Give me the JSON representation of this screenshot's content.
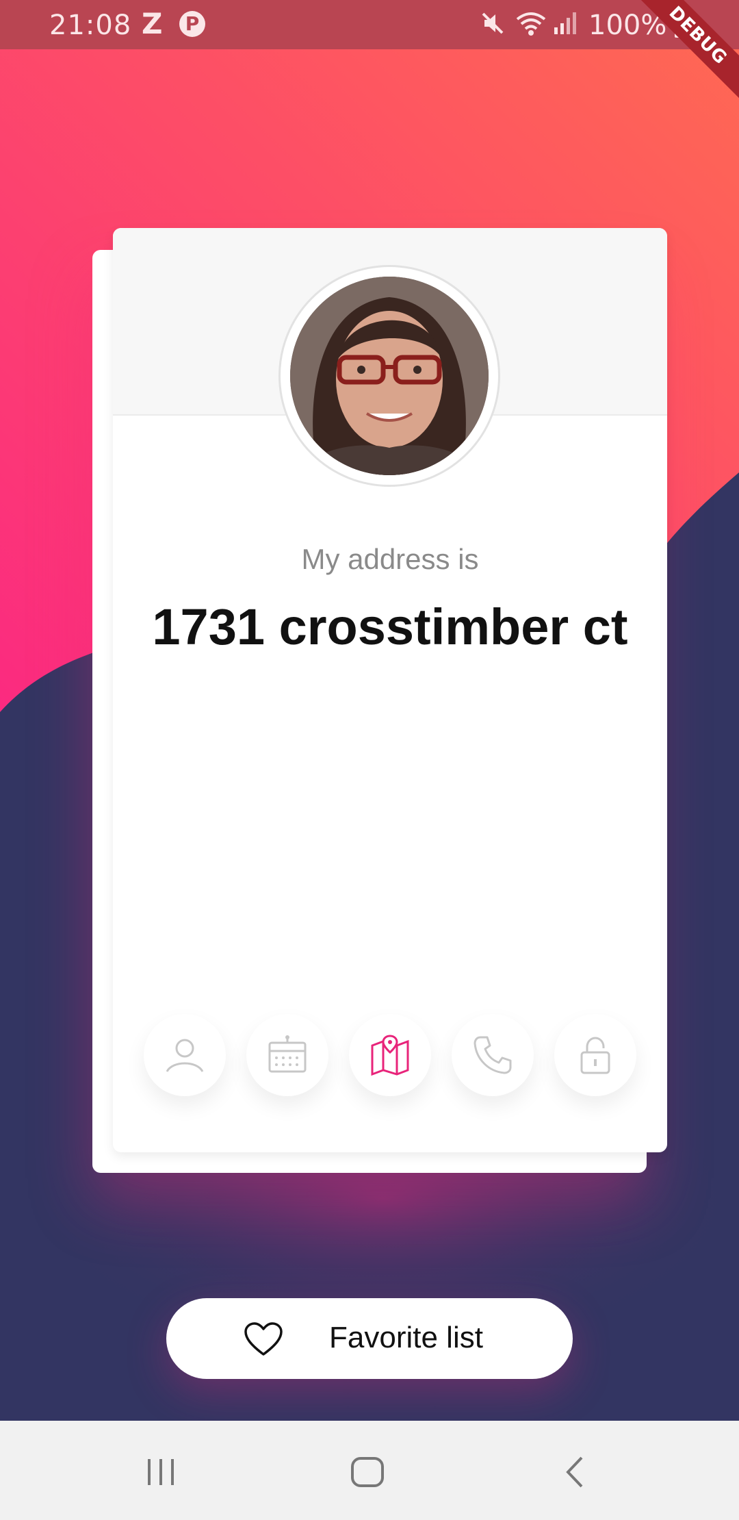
{
  "status_bar": {
    "time": "21:08",
    "app_z": "Z",
    "app_p": "P",
    "battery": "100%",
    "debug": "DEBUG"
  },
  "card": {
    "caption": "My address is",
    "value": "1731 crosstimber ct",
    "icons": [
      "user-icon",
      "calendar-icon",
      "map-icon",
      "phone-icon",
      "lock-icon"
    ],
    "active_icon": "map-icon"
  },
  "favorite_button": {
    "label": "Favorite list",
    "icon": "heart-icon"
  },
  "colors": {
    "accent": "#e8247a",
    "gradient_start": "#fb2d7b",
    "gradient_end": "#fe6a55",
    "dark_bg": "#333562",
    "inactive_icon": "#c7c7c7"
  }
}
